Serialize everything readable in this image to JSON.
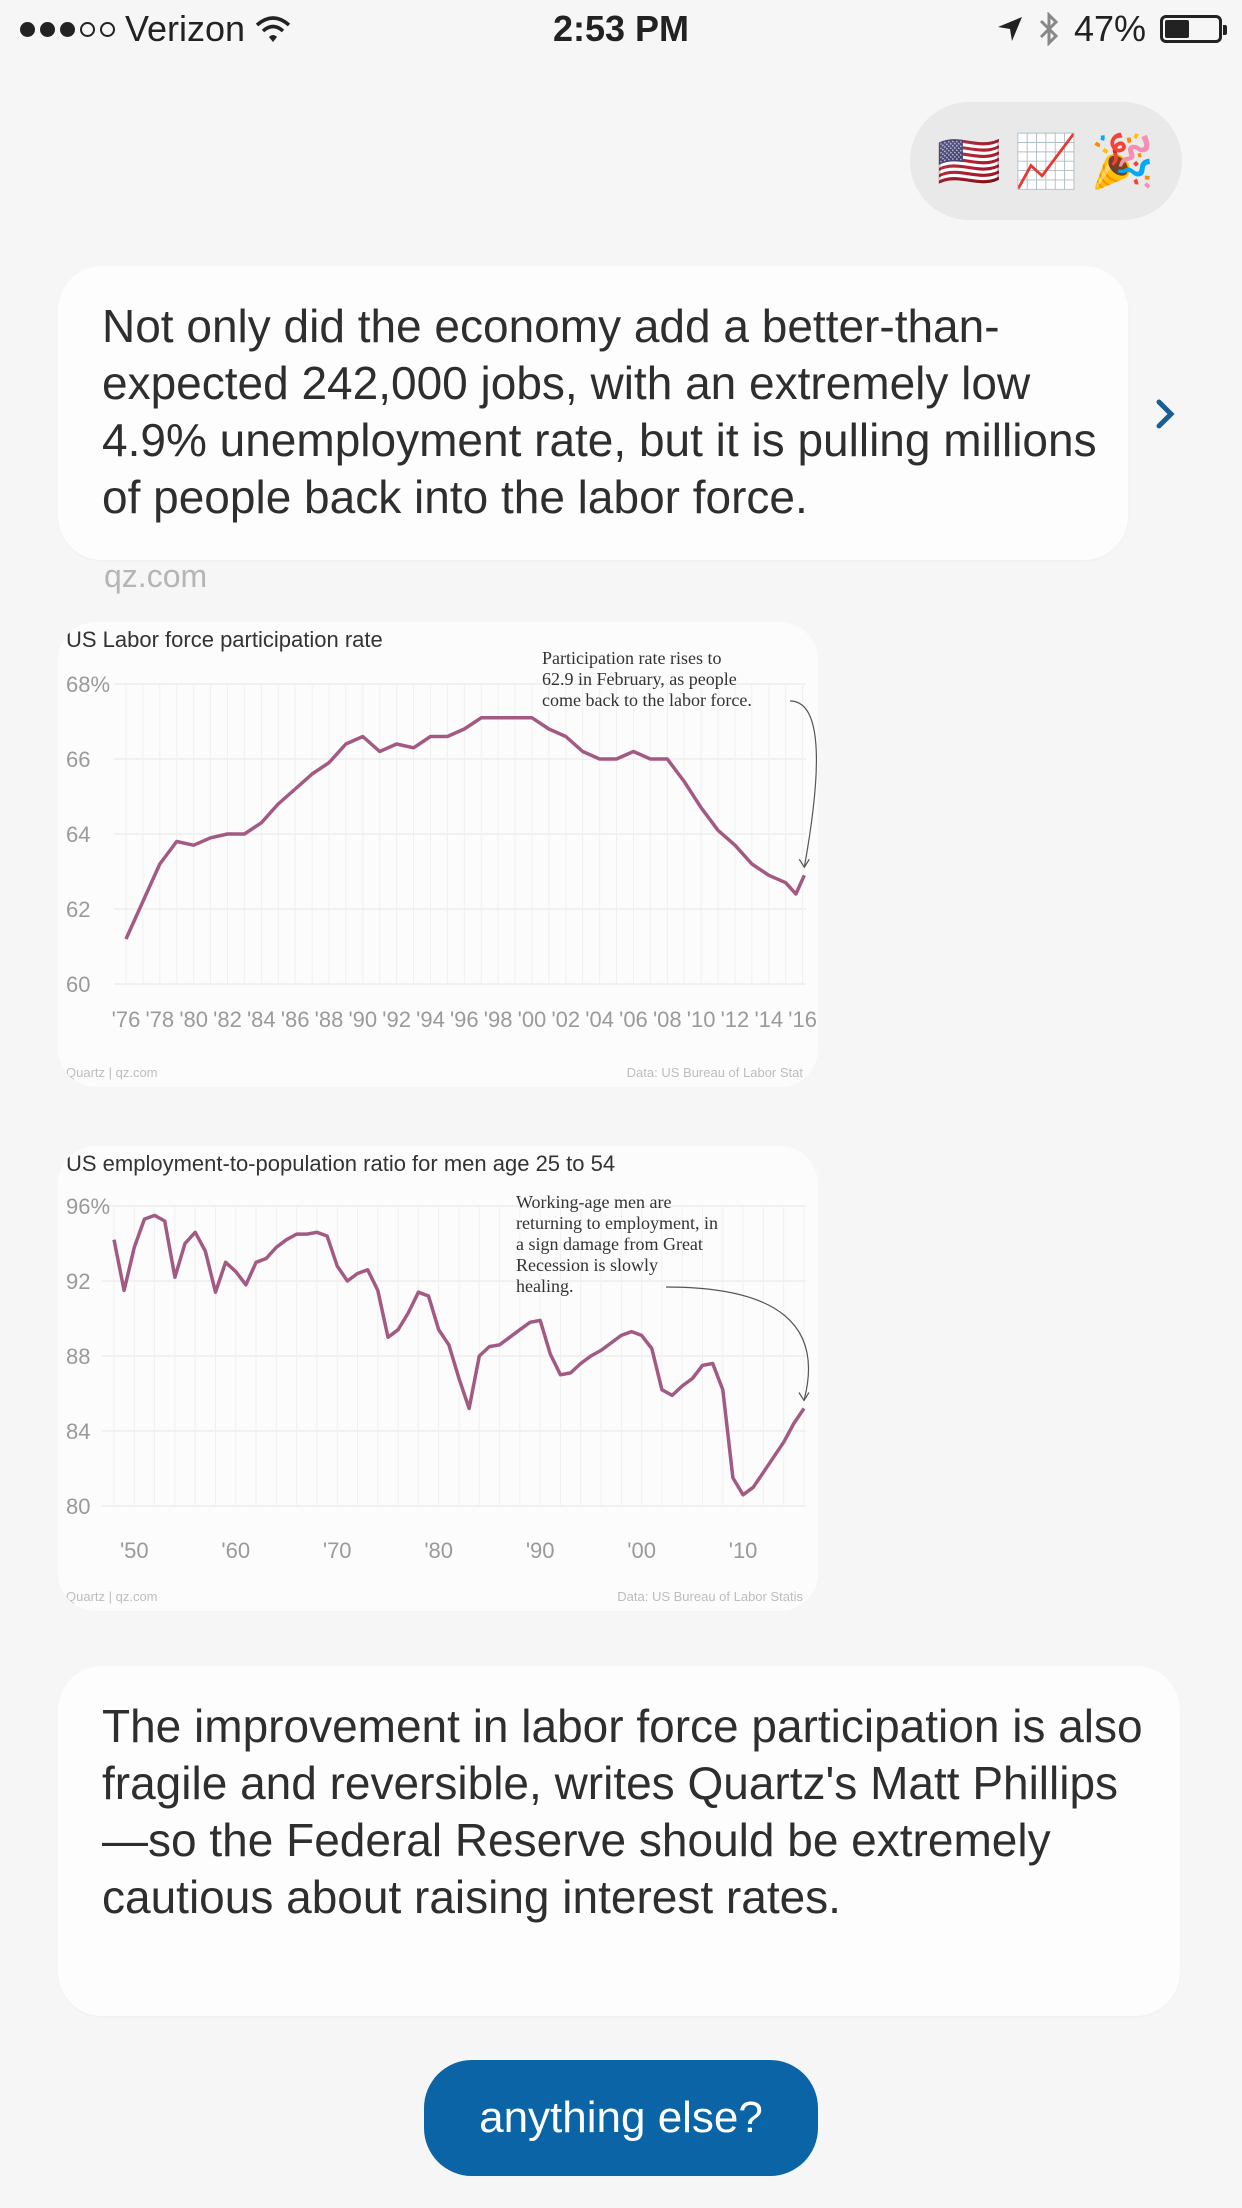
{
  "status_bar": {
    "carrier": "Verizon",
    "time": "2:53 PM",
    "battery": "47%",
    "battery_level": 0.47,
    "icons": [
      "signal-dots-icon",
      "wifi-icon",
      "location-arrow-icon",
      "bluetooth-icon",
      "battery-icon"
    ]
  },
  "emoji_reply": {
    "emojis": [
      "🇺🇸",
      "📈",
      "🎉"
    ]
  },
  "message1": {
    "text": "Not only did the economy add a better-than-expected 242,000 jobs, with an extremely low 4.9% unemployment rate, but it is pulling millions of people back into the labor force.",
    "source": "qz.com",
    "chevron_icon": "chevron-right-icon"
  },
  "message2": {
    "text": "The improvement in labor force participation is also fragile and reversible, writes Quartz's Matt Phillips—so the Federal Reserve should be extremely cautious about raising interest rates."
  },
  "button": {
    "label": "anything else?"
  },
  "colors": {
    "accent": "#0b64a5",
    "series": "#a35a82",
    "bubble": "#fdfdfd",
    "background": "#f6f6f6"
  },
  "chart_data": [
    {
      "type": "line",
      "title": "US Labor force participation rate",
      "xlabel": "",
      "ylabel": "",
      "ylim": [
        60,
        68
      ],
      "xlim": [
        1976,
        2016.2
      ],
      "y_ticks": [
        "68%",
        "66",
        "64",
        "62",
        "60"
      ],
      "y_tick_values": [
        68,
        66,
        64,
        62,
        60
      ],
      "x_ticks": [
        "'76",
        "'78",
        "'80",
        "'82",
        "'84",
        "'86",
        "'88",
        "'90",
        "'92",
        "'94",
        "'96",
        "'98",
        "'00",
        "'02",
        "'04",
        "'06",
        "'08",
        "'10",
        "'12",
        "'14",
        "'16"
      ],
      "x_tick_values": [
        1976,
        1978,
        1980,
        1982,
        1984,
        1986,
        1988,
        1990,
        1992,
        1994,
        1996,
        1998,
        2000,
        2002,
        2004,
        2006,
        2008,
        2010,
        2012,
        2014,
        2016
      ],
      "series": [
        {
          "x": [
            1976,
            1977,
            1978,
            1979,
            1980,
            1981,
            1982,
            1983,
            1984,
            1985,
            1986,
            1987,
            1988,
            1989,
            1990,
            1991,
            1992,
            1993,
            1994,
            1995,
            1996,
            1997,
            1998,
            1999,
            2000,
            2001,
            2002,
            2003,
            2004,
            2005,
            2006,
            2007,
            2008,
            2009,
            2010,
            2011,
            2012,
            2013,
            2014,
            2015,
            2015.6,
            2016.1
          ],
          "values": [
            61.2,
            62.2,
            63.2,
            63.8,
            63.7,
            63.9,
            64.0,
            64.0,
            64.3,
            64.8,
            65.2,
            65.6,
            65.9,
            66.4,
            66.6,
            66.2,
            66.4,
            66.3,
            66.6,
            66.6,
            66.8,
            67.1,
            67.1,
            67.1,
            67.1,
            66.8,
            66.6,
            66.2,
            66.0,
            66.0,
            66.2,
            66.0,
            66.0,
            65.4,
            64.7,
            64.1,
            63.7,
            63.2,
            62.9,
            62.7,
            62.4,
            62.9
          ]
        }
      ],
      "annotation": "Participation rate rises to 62.9 in February, as people come back to the labor force.",
      "footer_left": "Quartz | qz.com",
      "footer_right": "Data: US Bureau of Labor Stat"
    },
    {
      "type": "line",
      "title": "US employment-to-population ratio for men age 25 to 54",
      "xlabel": "",
      "ylabel": "",
      "ylim": [
        80,
        96
      ],
      "xlim": [
        1948,
        2016.2
      ],
      "y_ticks": [
        "96%",
        "92",
        "88",
        "84",
        "80"
      ],
      "y_tick_values": [
        96,
        92,
        88,
        84,
        80
      ],
      "x_ticks": [
        "'50",
        "'60",
        "'70",
        "'80",
        "'90",
        "'00",
        "'10"
      ],
      "x_tick_values": [
        1950,
        1960,
        1970,
        1980,
        1990,
        2000,
        2010
      ],
      "series": [
        {
          "x": [
            1948,
            1949,
            1950,
            1951,
            1952,
            1953,
            1954,
            1955,
            1956,
            1957,
            1958,
            1959,
            1960,
            1961,
            1962,
            1963,
            1964,
            1965,
            1966,
            1967,
            1968,
            1969,
            1970,
            1971,
            1972,
            1973,
            1974,
            1975,
            1976,
            1977,
            1978,
            1979,
            1980,
            1981,
            1982,
            1983,
            1984,
            1985,
            1986,
            1987,
            1988,
            1989,
            1990,
            1991,
            1992,
            1993,
            1994,
            1995,
            1996,
            1997,
            1998,
            1999,
            2000,
            2001,
            2002,
            2003,
            2004,
            2005,
            2006,
            2007,
            2008,
            2009,
            2010,
            2011,
            2012,
            2013,
            2014,
            2015,
            2016
          ],
          "values": [
            94.2,
            91.5,
            93.8,
            95.3,
            95.5,
            95.2,
            92.2,
            94.0,
            94.6,
            93.6,
            91.4,
            93.0,
            92.5,
            91.8,
            93.0,
            93.2,
            93.8,
            94.2,
            94.5,
            94.5,
            94.6,
            94.4,
            92.8,
            92.0,
            92.4,
            92.6,
            91.5,
            89.0,
            89.4,
            90.3,
            91.4,
            91.2,
            89.4,
            88.6,
            86.8,
            85.2,
            88.0,
            88.5,
            88.6,
            89.0,
            89.4,
            89.8,
            89.9,
            88.1,
            87.0,
            87.1,
            87.6,
            88.0,
            88.3,
            88.7,
            89.1,
            89.3,
            89.1,
            88.4,
            86.2,
            85.9,
            86.4,
            86.8,
            87.5,
            87.6,
            86.2,
            81.5,
            80.6,
            81.0,
            81.8,
            82.6,
            83.4,
            84.4,
            85.2
          ]
        }
      ],
      "annotation": "Working-age men are returning to employment, in a sign damage from Great Recession is slowly healing.",
      "footer_left": "Quartz | qz.com",
      "footer_right": "Data: US Bureau of Labor Statis"
    }
  ]
}
